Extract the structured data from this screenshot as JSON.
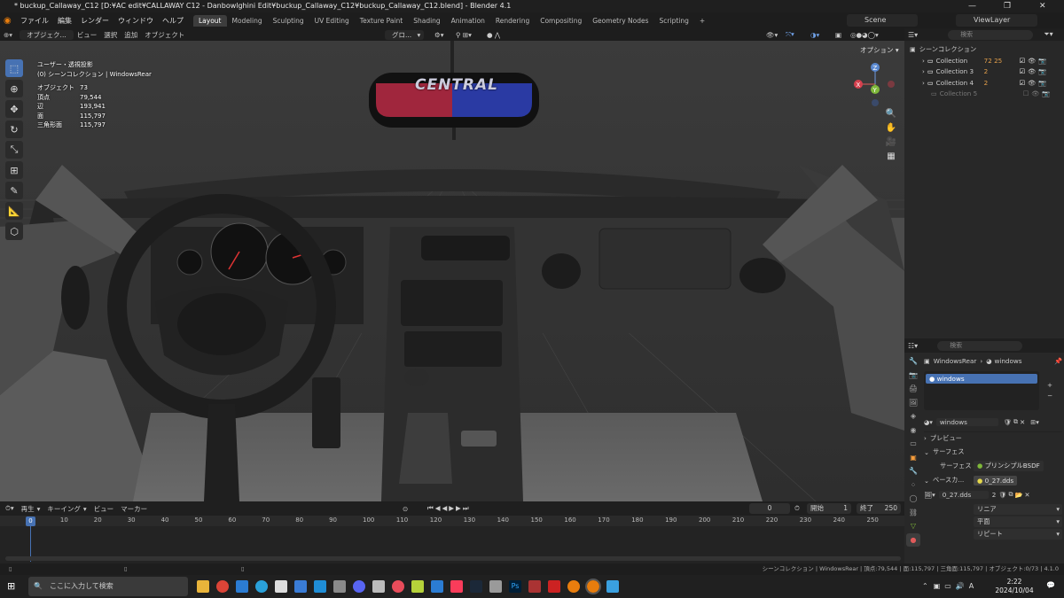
{
  "window": {
    "title": "* buckup_Callaway_C12 [D:¥AC edit¥CALLAWAY C12 - Danbowlghini Edit¥buckup_Callaway_C12¥buckup_Callaway_C12.blend] - Blender 4.1",
    "minimize": "—",
    "maximize": "❐",
    "close": "✕"
  },
  "menu": {
    "items": [
      "ファイル",
      "編集",
      "レンダー",
      "ウィンドウ",
      "ヘルプ"
    ],
    "workspaces": [
      "Layout",
      "Modeling",
      "Sculpting",
      "UV Editing",
      "Texture Paint",
      "Shading",
      "Animation",
      "Rendering",
      "Compositing",
      "Geometry Nodes",
      "Scripting",
      "+"
    ],
    "scene_label": "Scene",
    "viewlayer_label": "ViewLayer"
  },
  "viewport_header": {
    "mode": "オブジェク...",
    "menus": [
      "ビュー",
      "選択",
      "追加",
      "オブジェクト"
    ],
    "orientation": "グロ...",
    "options": "オプション"
  },
  "viewport": {
    "view_name": "ユーザー・透視投影",
    "collection_line": "(0) シーンコレクション | WindowsRear",
    "stats": [
      {
        "label": "オブジェクト",
        "value": "73"
      },
      {
        "label": "頂点",
        "value": "79,544"
      },
      {
        "label": "辺",
        "value": "193,941"
      },
      {
        "label": "面",
        "value": "115,797"
      },
      {
        "label": "三角形面",
        "value": "115,797"
      }
    ],
    "mirror_text": "CENTRAL",
    "gizmo_axes": {
      "z": "Z",
      "x": "X",
      "y": "Y"
    }
  },
  "outliner": {
    "search_placeholder": "検索",
    "root": "シーンコレクション",
    "collections": [
      {
        "name": "Collection",
        "badge": "72 25",
        "enabled": true
      },
      {
        "name": "Collection 3",
        "badge": "2",
        "enabled": true
      },
      {
        "name": "Collection 4",
        "badge": "2",
        "enabled": true
      },
      {
        "name": "Collection 5",
        "badge": "",
        "enabled": false
      }
    ]
  },
  "properties": {
    "search_placeholder": "検索",
    "breadcrumb_object": "WindowsRear",
    "breadcrumb_material": "windows",
    "material_slot": "windows",
    "material_name": "windows",
    "preview_label": "プレビュー",
    "surface_panel": "サーフェス",
    "surface_label": "サーフェス",
    "surface_value": "プリンシプルBSDF",
    "base_color_label": "ベースカ...",
    "base_color_value": "0_27.dds",
    "image_name": "0_27.dds",
    "image_users": "2",
    "interpolation": "リニア",
    "projection": "平面",
    "extension": "リピート"
  },
  "timeline": {
    "menus": [
      "再生",
      "キーイング",
      "ビュー",
      "マーカー"
    ],
    "current_frame": "0",
    "start_label": "開始",
    "start_value": "1",
    "end_label": "終了",
    "end_value": "250",
    "ticks": [
      "0",
      "10",
      "20",
      "30",
      "40",
      "50",
      "60",
      "70",
      "80",
      "90",
      "100",
      "110",
      "120",
      "130",
      "140",
      "150",
      "160",
      "170",
      "180",
      "190",
      "200",
      "210",
      "220",
      "230",
      "240",
      "250"
    ]
  },
  "statusbar": {
    "text": "シーンコレクション | WindowsRear | 頂点:79,544 | 面:115,797 | 三角面:115,797 | オブジェクト:0/73 | 4.1.0"
  },
  "taskbar": {
    "search_placeholder": "ここに入力して検索",
    "time": "2:22",
    "date": "2024/10/04"
  },
  "colors": {
    "accent": "#4772b3",
    "active_tab": "#3d3d3d",
    "viewport_bg": "#393939"
  }
}
